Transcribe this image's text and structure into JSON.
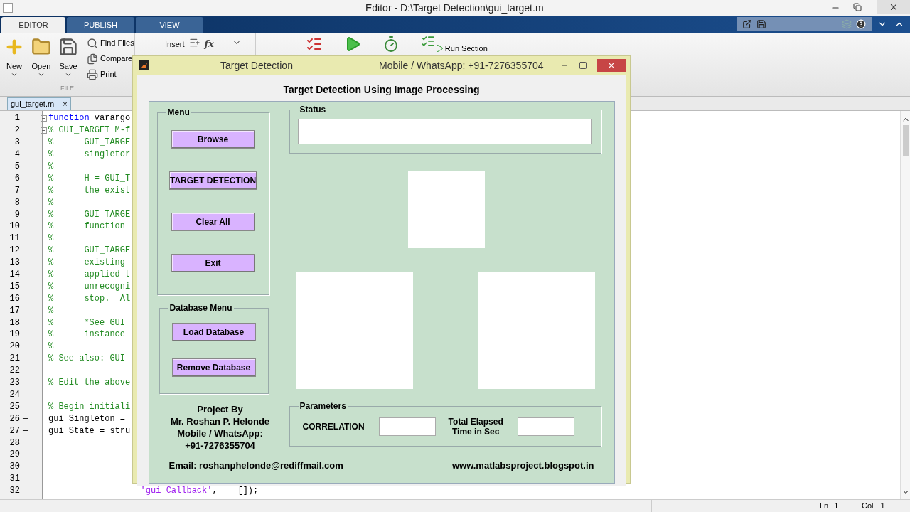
{
  "window": {
    "title": "Editor - D:\\Target Detection\\gui_target.m"
  },
  "ribbon_tabs": [
    {
      "label": "EDITOR",
      "selected": true
    },
    {
      "label": "PUBLISH",
      "selected": false
    },
    {
      "label": "VIEW",
      "selected": false
    }
  ],
  "ribbon": {
    "file_buttons": [
      {
        "label": "New",
        "kind": "new"
      },
      {
        "label": "Open",
        "kind": "open"
      },
      {
        "label": "Save",
        "kind": "save"
      }
    ],
    "file_small": [
      {
        "label": "Find Files",
        "kind": "find"
      },
      {
        "label": "Compare",
        "kind": "compare"
      },
      {
        "label": "Print",
        "kind": "print"
      }
    ],
    "file_section": "FILE",
    "insert": "Insert",
    "fx": "fx",
    "run_section": "Run Section"
  },
  "editor": {
    "file_tab": {
      "label": "gui_target.m",
      "close": "×"
    },
    "lines": [
      {
        "num": "1",
        "fold": true,
        "segments": [
          {
            "text": "function",
            "kind": "keyword"
          },
          {
            "text": " varargo",
            "kind": "code"
          }
        ]
      },
      {
        "num": "2",
        "fold": true,
        "segments": [
          {
            "text": "% GUI_TARGET M-f",
            "kind": "comment"
          }
        ]
      },
      {
        "num": "3",
        "segments": [
          {
            "text": "%      GUI_TARGE",
            "kind": "comment"
          }
        ]
      },
      {
        "num": "4",
        "segments": [
          {
            "text": "%      singletor",
            "kind": "comment"
          }
        ]
      },
      {
        "num": "5",
        "segments": [
          {
            "text": "%",
            "kind": "comment"
          }
        ]
      },
      {
        "num": "6",
        "segments": [
          {
            "text": "%      H = GUI_T",
            "kind": "comment"
          }
        ]
      },
      {
        "num": "7",
        "segments": [
          {
            "text": "%      the exist",
            "kind": "comment"
          }
        ]
      },
      {
        "num": "8",
        "segments": [
          {
            "text": "%",
            "kind": "comment"
          }
        ]
      },
      {
        "num": "9",
        "segments": [
          {
            "text": "%      GUI_TARGE",
            "kind": "comment"
          }
        ]
      },
      {
        "num": "10",
        "segments": [
          {
            "text": "%      function",
            "kind": "comment"
          }
        ]
      },
      {
        "num": "11",
        "segments": [
          {
            "text": "%",
            "kind": "comment"
          }
        ]
      },
      {
        "num": "12",
        "segments": [
          {
            "text": "%      GUI_TARGE",
            "kind": "comment"
          }
        ]
      },
      {
        "num": "13",
        "segments": [
          {
            "text": "%      existing",
            "kind": "comment"
          }
        ]
      },
      {
        "num": "14",
        "segments": [
          {
            "text": "%      applied t",
            "kind": "comment"
          }
        ]
      },
      {
        "num": "15",
        "segments": [
          {
            "text": "%      unrecogni",
            "kind": "comment"
          }
        ]
      },
      {
        "num": "16",
        "segments": [
          {
            "text": "%      stop.  Al",
            "kind": "comment"
          }
        ]
      },
      {
        "num": "17",
        "segments": [
          {
            "text": "%",
            "kind": "comment"
          }
        ]
      },
      {
        "num": "18",
        "segments": [
          {
            "text": "%      *See GUI",
            "kind": "comment"
          }
        ]
      },
      {
        "num": "19",
        "segments": [
          {
            "text": "%      instance",
            "kind": "comment"
          }
        ]
      },
      {
        "num": "20",
        "segments": [
          {
            "text": "%",
            "kind": "comment"
          }
        ]
      },
      {
        "num": "21",
        "segments": [
          {
            "text": "% See also: GUI",
            "kind": "comment"
          }
        ]
      },
      {
        "num": "22"
      },
      {
        "num": "23",
        "segments": [
          {
            "text": "% Edit the above",
            "kind": "comment"
          }
        ]
      },
      {
        "num": "24"
      },
      {
        "num": "25",
        "segments": [
          {
            "text": "% Begin initiali",
            "kind": "comment"
          }
        ]
      },
      {
        "num": "26",
        "marker": "—",
        "segments": [
          {
            "text": "gui_Singleton =",
            "kind": "code"
          }
        ]
      },
      {
        "num": "27",
        "marker": "—",
        "segments": [
          {
            "text": "gui_State = stru",
            "kind": "code"
          }
        ]
      },
      {
        "num": "28"
      },
      {
        "num": "29"
      },
      {
        "num": "30"
      },
      {
        "num": "31"
      },
      {
        "num": "32",
        "segments": [
          {
            "text": "                  'gui_Callback'",
            "kind": "string"
          },
          {
            "text": ",    []);",
            "kind": "code"
          }
        ]
      }
    ]
  },
  "status_bar": {
    "line": "Ln",
    "line_value": "1",
    "col": "Col",
    "col_value": "1"
  },
  "figure": {
    "title": "Target Detection",
    "contact": "Mobile / WhatsApp: +91-7276355704",
    "close": "×",
    "heading": "Target Detection Using Image Processing",
    "menu_panel": {
      "title": "Menu",
      "buttons": [
        "Browse",
        "TARGET DETECTION",
        "Clear All",
        "Exit"
      ]
    },
    "database_panel": {
      "title": "Database Menu",
      "buttons": [
        "Load Database",
        "Remove Database"
      ]
    },
    "status_panel": {
      "title": "Status"
    },
    "credits": [
      "Project By",
      "Mr. Roshan P. Helonde",
      "Mobile / WhatsApp:",
      "+91-7276355704"
    ],
    "parameters_panel": {
      "title": "Parameters",
      "fields": [
        {
          "label": "CORRELATION"
        },
        {
          "label": "Total Elapsed\nTime in Sec"
        }
      ]
    },
    "email": "Email: roshanphelonde@rediffmail.com",
    "website": "www.matlabsproject.blogspot.in"
  }
}
